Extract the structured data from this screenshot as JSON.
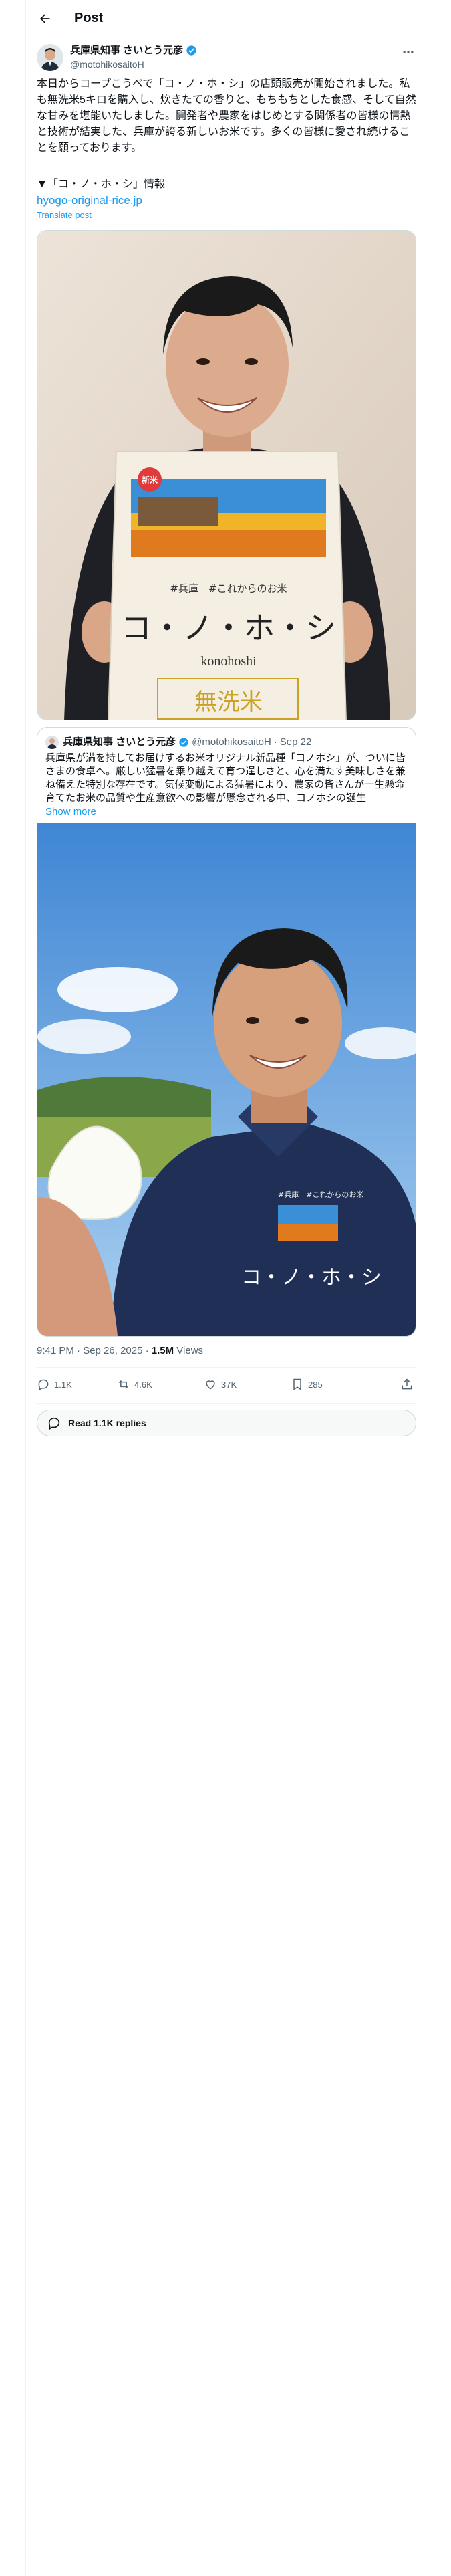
{
  "header": {
    "title": "Post"
  },
  "author": {
    "name": "兵庫県知事 さいとう元彦",
    "handle": "@motohikosaitoH"
  },
  "post": {
    "text": "本日からコープこうべで「コ・ノ・ホ・シ」の店頭販売が開始されました。私も無洗米5キロを購入し、炊きたての香りと、もちもちとした食感、そして自然な甘みを堪能いたしました。開発者や農家をはじめとする関係者の皆様の情熱と技術が結実した、兵庫が誇る新しいお米です。多くの皆様に愛され続けることを願っております。",
    "info_heading": "▼「コ・ノ・ホ・シ」情報",
    "link": "hyogo-original-rice.jp",
    "translate": "Translate post"
  },
  "media": {
    "bag_brand": "新米",
    "bag_region": "#兵庫　#これからのお米",
    "bag_name": "コ・ノ・ホ・シ",
    "bag_romaji": "konohoshi",
    "bag_bottom": "無洗米"
  },
  "quote": {
    "name": "兵庫県知事 さいとう元彦",
    "handle": "@motohikosaitoH",
    "dot": "·",
    "date": "Sep 22",
    "text": "兵庫県が満を持してお届けするお米オリジナル新品種「コノホシ」が、ついに皆さまの食卓へ。厳しい猛暑を乗り越えて育つ逞しさと、心を満たす美味しさを兼ね備えた特別な存在です。気候変動による猛暑により、農家の皆さんが一生懸命育てたお米の品質や生産意欲への影響が懸念される中、コノホシの誕生",
    "show_more": "Show more",
    "shirt_text": "コ・ノ・ホ・シ",
    "shirt_small": "#兵庫　#これからのお米"
  },
  "meta": {
    "time": "9:41 PM · Sep 26, 2025 · ",
    "views_count": "1.5M",
    "views_label": " Views"
  },
  "actions": {
    "replies": "1.1K",
    "reposts": "4.6K",
    "likes": "37K",
    "bookmarks": "285"
  },
  "read_replies": "Read 1.1K replies",
  "colors": {
    "accent": "#1d9bf0",
    "verified": "#1d9bf0",
    "muted": "#536471"
  }
}
